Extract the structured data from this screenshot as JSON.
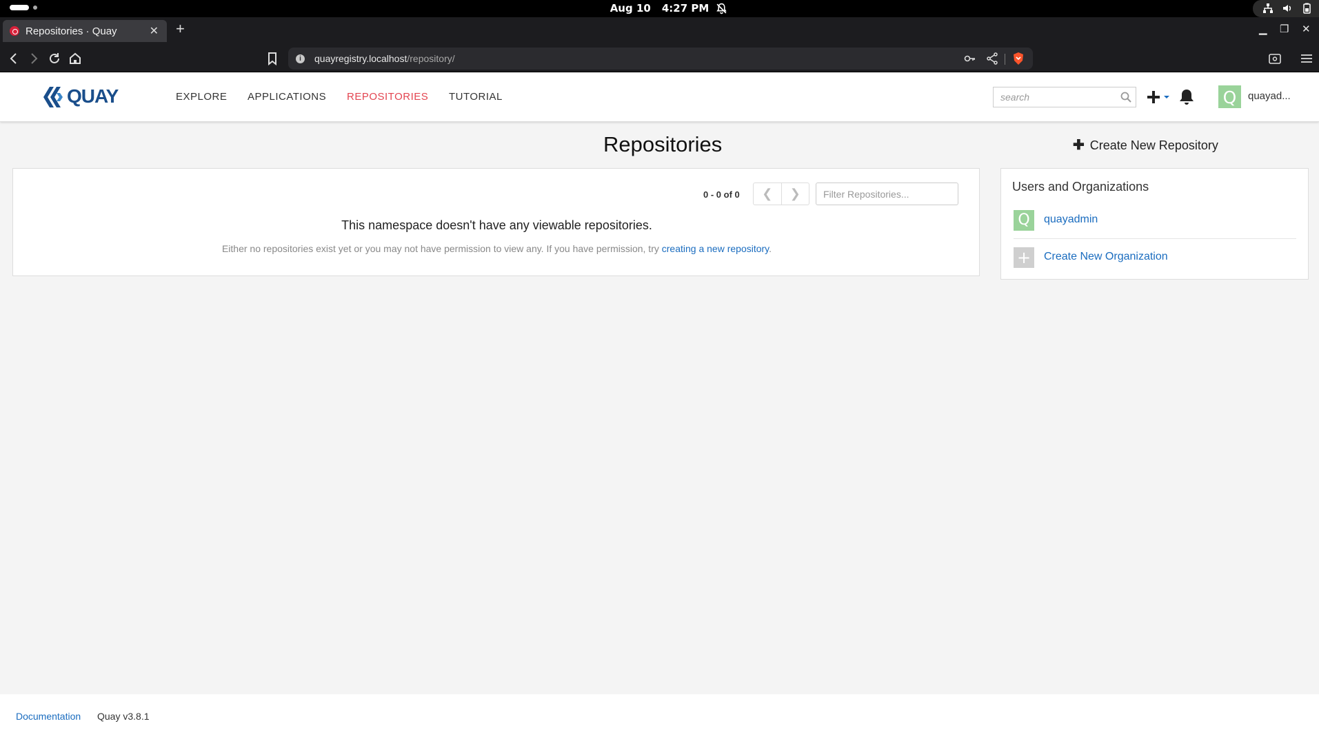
{
  "system": {
    "date": "Aug 10",
    "time": "4:27 PM"
  },
  "browser": {
    "tab_title": "Repositories · Quay",
    "url_host": "quayregistry.localhost",
    "url_path": "/repository/"
  },
  "header": {
    "logo_text": "QUAY",
    "nav": [
      "EXPLORE",
      "APPLICATIONS",
      "REPOSITORIES",
      "TUTORIAL"
    ],
    "active_nav": "REPOSITORIES",
    "search_placeholder": "search",
    "avatar_letter": "Q",
    "username": "quayad..."
  },
  "main": {
    "title": "Repositories",
    "create_repo_label": "Create New Repository",
    "pagination": "0 - 0 of 0",
    "filter_placeholder": "Filter Repositories...",
    "empty_title": "This namespace doesn't have any viewable repositories.",
    "empty_sub_prefix": "Either no repositories exist yet or you may not have permission to view any. If you have permission, try ",
    "empty_sub_link": "creating a new repository",
    "empty_sub_suffix": "."
  },
  "sidebar": {
    "heading": "Users and Organizations",
    "user_avatar_letter": "Q",
    "user_name": "quayadmin",
    "create_org_label": "Create New Organization"
  },
  "footer": {
    "documentation": "Documentation",
    "version": "Quay v3.8.1"
  },
  "colors": {
    "accent_active_nav": "#e34450",
    "link": "#1a6cbf",
    "brand": "#1a4e8b",
    "avatar": "#9ad39a"
  }
}
